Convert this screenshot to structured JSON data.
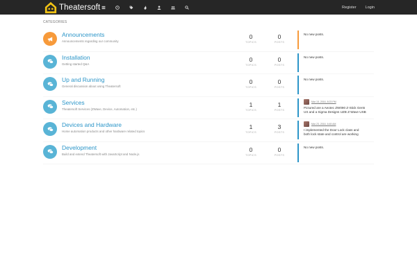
{
  "app": {
    "brand": "Theatersoft"
  },
  "nav": {
    "icons": [
      "list-icon",
      "clock-icon",
      "tags-icon",
      "fire-icon",
      "user-icon",
      "group-icon",
      "search-icon"
    ],
    "register": "Register",
    "login": "Login"
  },
  "categories_header": "CATEGORIES",
  "categories": [
    {
      "title": "Announcements",
      "desc": "Announcements regarding our community",
      "topics": "0",
      "posts": "0",
      "topics_label": "TOPICS",
      "posts_label": "POSTS",
      "color": "#f79a3a",
      "icon": "bullhorn-icon",
      "last": {
        "empty": "No new posts."
      }
    },
    {
      "title": "Installation",
      "desc": "Getting started Q&A",
      "topics": "0",
      "posts": "0",
      "topics_label": "TOPICS",
      "posts_label": "POSTS",
      "color": "#59b4d6",
      "icon": "comments-icon",
      "last": {
        "empty": "No new posts."
      }
    },
    {
      "title": "Up and Running",
      "desc": "General discussion about using Theatersoft",
      "topics": "0",
      "posts": "0",
      "topics_label": "TOPICS",
      "posts_label": "POSTS",
      "color": "#59b4d6",
      "icon": "comments-icon",
      "last": {
        "empty": "No new posts."
      }
    },
    {
      "title": "Services",
      "desc": "Theatersoft Services (ZWave, Device, Automation, etc.)",
      "topics": "1",
      "posts": "1",
      "topics_label": "TOPICS",
      "posts_label": "POSTS",
      "color": "#59b4d6",
      "icon": "comments-icon",
      "last": {
        "time": "Mar 15, 2016, 8:23 PM",
        "line1": "Pictured are a Aeotec ZW090 Z-Stick Gen5",
        "line2": "US and a Sigma Designs UZB Z-Wave USB"
      }
    },
    {
      "title": "Devices and Hardware",
      "desc": "Home automation products and other hardware related topics",
      "topics": "1",
      "posts": "3",
      "topics_label": "TOPICS",
      "posts_label": "POSTS",
      "color": "#59b4d6",
      "icon": "comments-icon",
      "last": {
        "time": "Mar 23, 2016, 6:45 AM",
        "line1": "I implemented the Door Lock class and",
        "line2": "both lock state and control are working"
      }
    },
    {
      "title": "Development",
      "desc": "Build and extend Theatersoft with JavaScript and Node.js",
      "topics": "0",
      "posts": "0",
      "topics_label": "TOPICS",
      "posts_label": "POSTS",
      "color": "#59b4d6",
      "icon": "comments-icon",
      "last": {
        "empty": "No new posts."
      }
    }
  ],
  "colors": {
    "nav_bg": "#262626",
    "link": "#2b95c8",
    "accent_orange": "#f79a3a",
    "accent_blue": "#59b4d6"
  }
}
